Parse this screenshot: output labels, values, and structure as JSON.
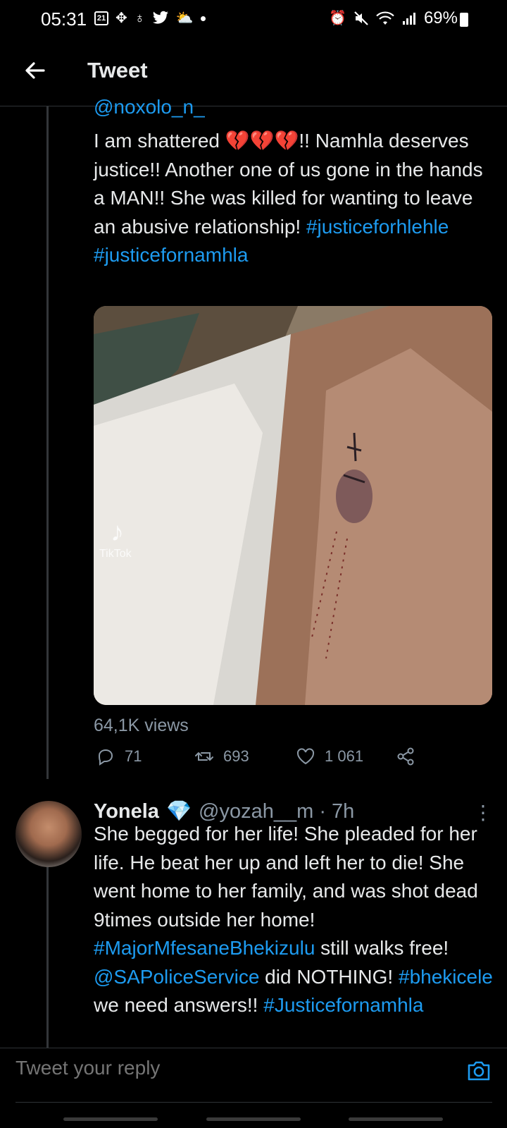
{
  "status_bar": {
    "time": "05:31",
    "calendar_day": "21",
    "battery": "69%"
  },
  "header": {
    "title": "Tweet"
  },
  "parent_tweet": {
    "handle": "@noxolo_n_",
    "text_before_hearts": "I am shattered ",
    "hearts": "💔💔💔",
    "text_after_hearts": "!! Namhla deserves justice!! Another one of us gone in the hands a MAN!! She was killed for wanting to leave an abusive relationship! ",
    "hashtag_1": "#justiceforhlehle",
    "hashtag_2": "#justicefornamhla",
    "media_watermark": "TikTok",
    "views": "64,1K views",
    "replies": "71",
    "retweets": "693",
    "likes": "1 061"
  },
  "reply_tweet": {
    "name": "Yonela",
    "verified_badge": "💎",
    "handle_time": "@yozah__m · 7h",
    "text_1": "She begged for her life! She pleaded for her life. He beat her up and left her to die! She went home to her family, and was shot dead 9times outside her home! ",
    "hashtag_1": "#MajorMfesaneBhekizulu",
    "text_2": " still walks free! ",
    "mention_1": "@SAPoliceService",
    "text_3": " did NOTHING! ",
    "hashtag_2": "#bhekicele",
    "text_4": " we need answers!! ",
    "hashtag_3": "#Justicefornamhla"
  },
  "composer": {
    "placeholder": "Tweet your reply"
  },
  "colors": {
    "accent": "#1d9bf0",
    "background": "#000000",
    "muted": "#8b98a5"
  }
}
